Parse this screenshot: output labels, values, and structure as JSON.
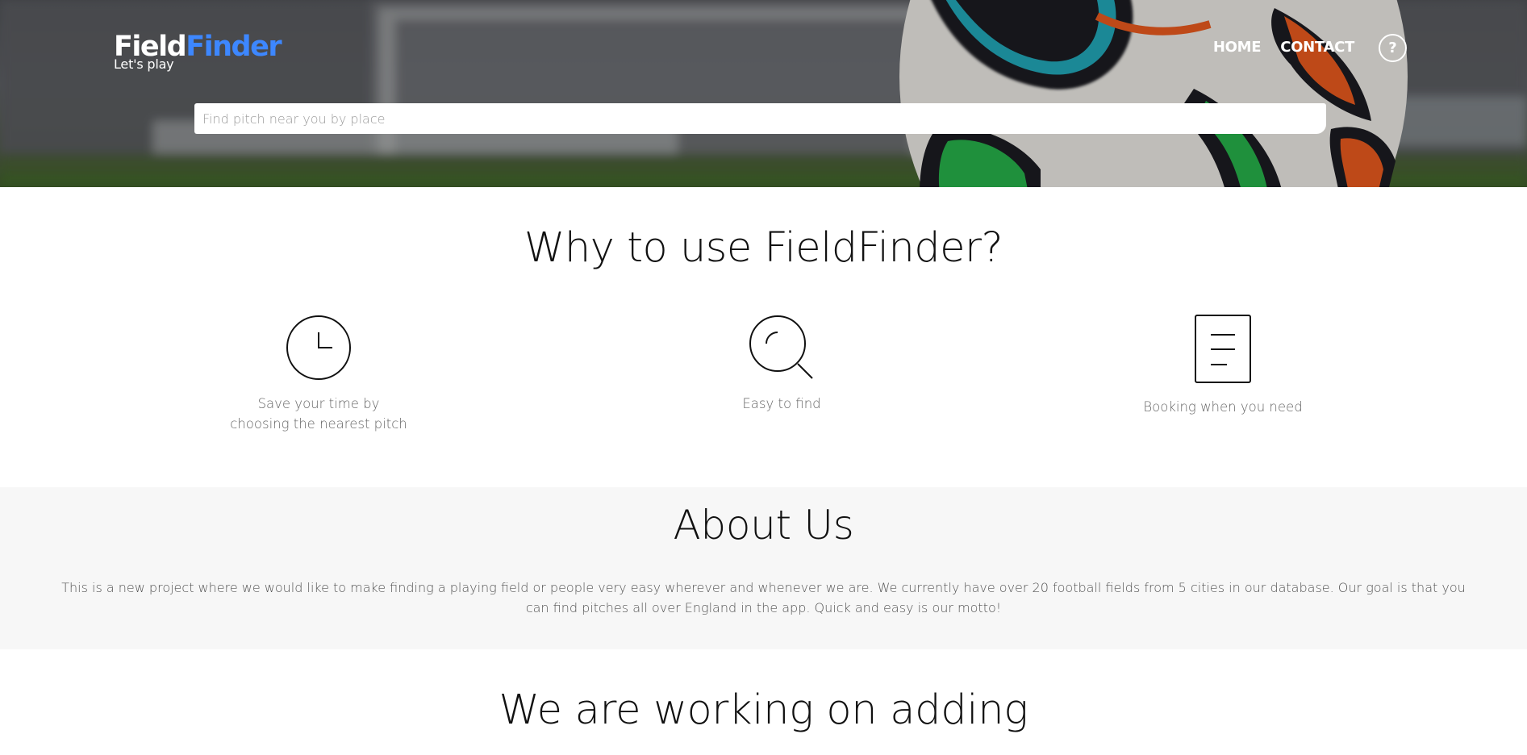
{
  "header": {
    "brand": {
      "part1": "Field",
      "part2": "Finder",
      "tagline": "Let's play"
    },
    "nav": {
      "home_label": "HOME",
      "contact_label": "CONTACT",
      "help_label": "?"
    },
    "search": {
      "placeholder": "Find pitch near you by place",
      "value": ""
    }
  },
  "why": {
    "title": "Why to use FieldFinder?",
    "features": [
      {
        "icon": "clock-icon",
        "label": "Save your time by choosing the nearest pitch"
      },
      {
        "icon": "search-icon",
        "label": "Easy to find"
      },
      {
        "icon": "document-icon",
        "label": "Booking when you need"
      }
    ]
  },
  "about": {
    "title": "About Us",
    "text": "This is a new project where we would like to make finding a playing field or people very easy wherever and whenever we are. We currently have over 20 football fields from 5 cities in our database. Our goal is that you can find pitches all over England in the app. Quick and easy is our motto!"
  },
  "working": {
    "title": "We are working on adding"
  },
  "colors": {
    "brand_blue": "#3d87ff",
    "text_dark": "#111111",
    "text_muted": "#666666",
    "about_bg": "#f7f7f7"
  }
}
